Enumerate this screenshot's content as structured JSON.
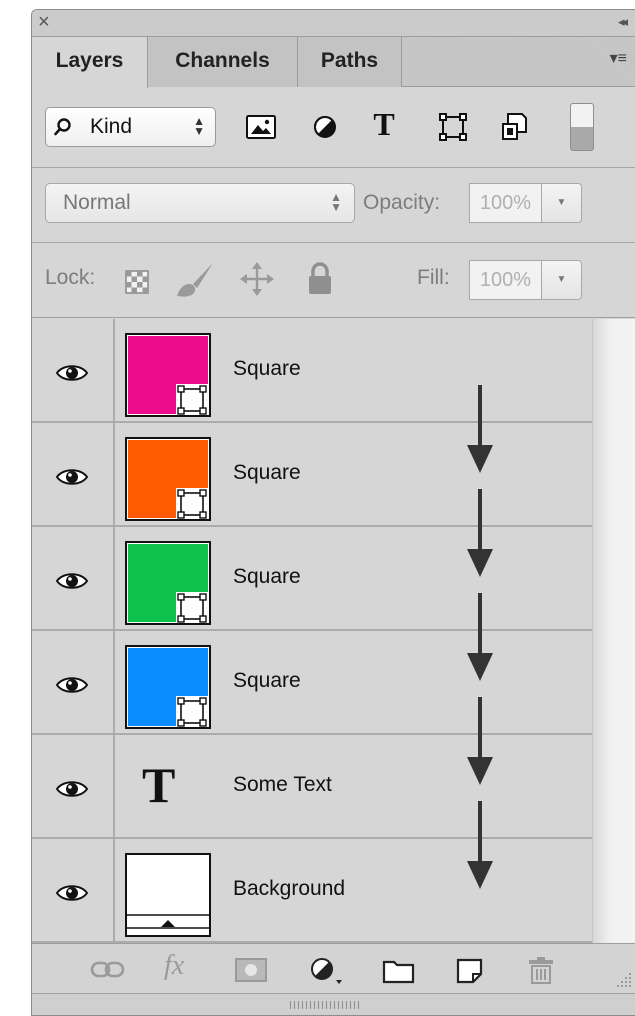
{
  "window": {
    "close_glyph": "×",
    "collapse_glyph": "◂◂"
  },
  "tabs": [
    {
      "label": "Layers",
      "active": true
    },
    {
      "label": "Channels",
      "active": false
    },
    {
      "label": "Paths",
      "active": false
    }
  ],
  "panel_menu_glyph": "▾≡",
  "filter": {
    "kind_label": "Kind",
    "icons": [
      "image-filter-icon",
      "adjustment-filter-icon",
      "type-filter-icon",
      "shape-filter-icon",
      "smart-object-filter-icon"
    ],
    "type_glyph": "T"
  },
  "blend": {
    "mode": "Normal",
    "opacity_label": "Opacity:",
    "opacity_value": "100%"
  },
  "lock": {
    "label": "Lock:",
    "fill_label": "Fill:",
    "fill_value": "100%"
  },
  "layers": [
    {
      "name": "Square",
      "kind": "shape",
      "color": "#ec0c8c",
      "visible": true
    },
    {
      "name": "Square",
      "kind": "shape",
      "color": "#ff5a00",
      "visible": true
    },
    {
      "name": "Square",
      "kind": "shape",
      "color": "#0ec14a",
      "visible": true
    },
    {
      "name": "Square",
      "kind": "shape",
      "color": "#0a8cff",
      "visible": true
    },
    {
      "name": "Some Text",
      "kind": "text",
      "glyph": "T",
      "visible": true
    },
    {
      "name": "Background",
      "kind": "background",
      "color": "#ffffff",
      "visible": true
    }
  ],
  "bottom_bar": {
    "icons": [
      "link-layers-icon",
      "fx-icon",
      "layer-mask-icon",
      "adjustment-layer-icon",
      "new-group-icon",
      "new-layer-icon",
      "delete-icon"
    ],
    "fx_label": "fx"
  }
}
